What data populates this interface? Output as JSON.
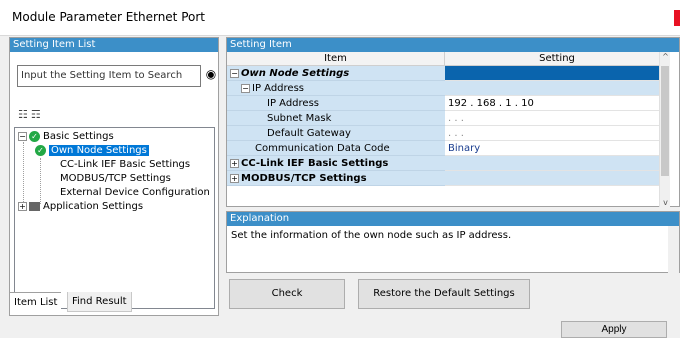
{
  "window": {
    "title": "Module Parameter Ethernet Port"
  },
  "left_pane": {
    "header": "Setting Item List",
    "search_placeholder": "Input the Setting Item to Search",
    "tree": [
      {
        "label": "Basic Settings",
        "expanded": true
      },
      {
        "label": "Own Node Settings",
        "selected": true
      },
      {
        "label": "CC-Link IEF Basic Settings"
      },
      {
        "label": "MODBUS/TCP Settings"
      },
      {
        "label": "External Device Configuration"
      },
      {
        "label": "Application Settings",
        "expanded": false
      }
    ],
    "tabs": [
      "Item List",
      "Find Result"
    ]
  },
  "right_pane": {
    "header": "Setting Item",
    "columns": {
      "item": "Item",
      "setting": "Setting"
    },
    "rows": [
      {
        "item": "Own Node Settings",
        "setting": ""
      },
      {
        "item": "IP Address",
        "setting": ""
      },
      {
        "item": "IP Address",
        "setting": "192 . 168 .  1  . 10"
      },
      {
        "item": "Subnet Mask",
        "setting": ".       .       ."
      },
      {
        "item": "Default Gateway",
        "setting": ".       .       ."
      },
      {
        "item": "Communication Data Code",
        "setting": "Binary"
      },
      {
        "item": "CC-Link IEF Basic Settings",
        "setting": ""
      },
      {
        "item": "MODBUS/TCP Settings",
        "setting": ""
      }
    ]
  },
  "explanation": {
    "header": "Explanation",
    "text": "Set the information of the own node such as IP address."
  },
  "buttons": {
    "check": "Check",
    "restore": "Restore the Default Settings",
    "apply": "Apply"
  },
  "colors": {
    "header_blue": "#3c8fc8",
    "selection_blue": "#0078d7",
    "row_blue": "#cfe3f3",
    "check_green": "#22a845"
  }
}
